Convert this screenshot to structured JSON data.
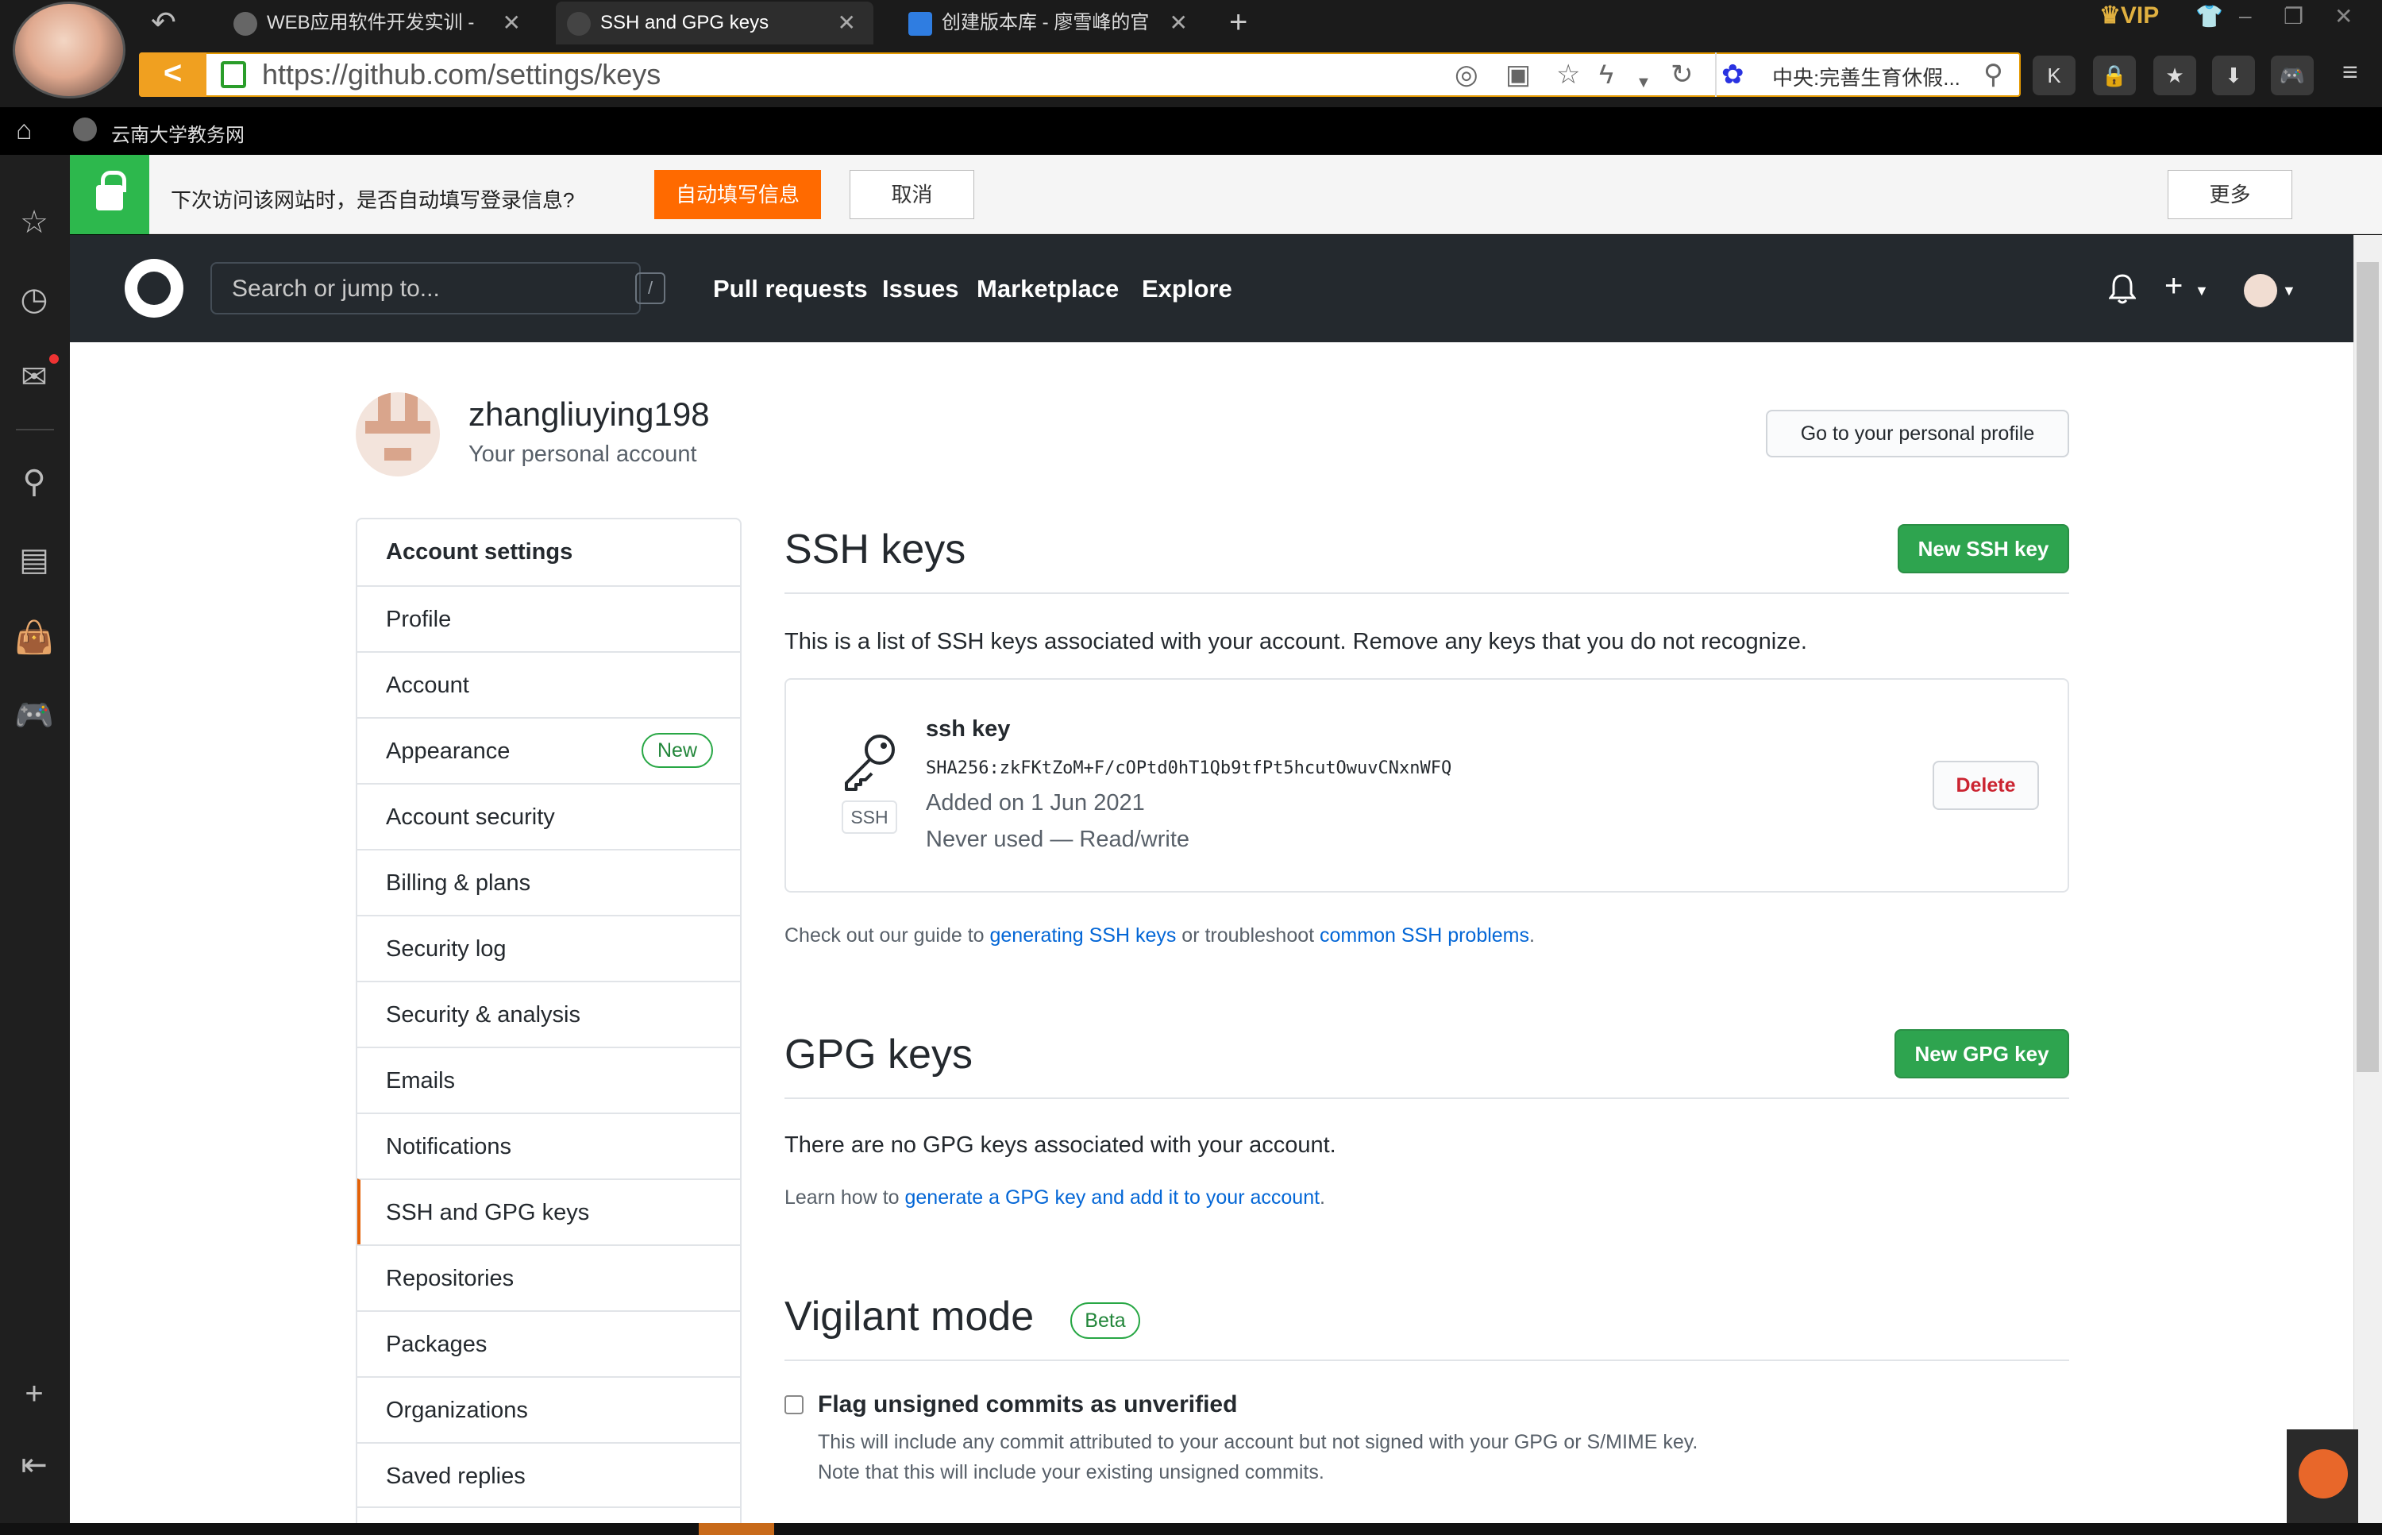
{
  "browser": {
    "tabs": [
      {
        "label": "WEB应用软件开发实训 -",
        "active": false
      },
      {
        "label": "SSH and GPG keys",
        "active": true
      },
      {
        "label": "创建版本库 - 廖雪峰的官",
        "active": false
      }
    ],
    "url": "https://github.com/settings/keys",
    "search_engine_text": "中央:完善生育休假...",
    "vip_label": "VIP",
    "bookmark": "云南大学教务网",
    "accent_color": "#e59a00"
  },
  "autofill": {
    "message": "下次访问该网站时，是否自动填写登录信息?",
    "confirm_label": "自动填写信息",
    "cancel_label": "取消",
    "more_label": "更多"
  },
  "github_header": {
    "search_placeholder": "Search or jump to...",
    "search_shortcut": "/",
    "nav": [
      "Pull requests",
      "Issues",
      "Marketplace",
      "Explore"
    ]
  },
  "account": {
    "username": "zhangliuying198",
    "subtitle": "Your personal account",
    "profile_button": "Go to your personal profile"
  },
  "settings_menu": {
    "items": [
      "Account settings",
      "Profile",
      "Account",
      "Appearance",
      "Account security",
      "Billing & plans",
      "Security log",
      "Security & analysis",
      "Emails",
      "Notifications",
      "SSH and GPG keys",
      "Repositories",
      "Packages",
      "Organizations",
      "Saved replies"
    ],
    "selected": "SSH and GPG keys",
    "new_badge": "New"
  },
  "ssh": {
    "title": "SSH keys",
    "new_button": "New SSH key",
    "description": "This is a list of SSH keys associated with your account. Remove any keys that you do not recognize.",
    "key": {
      "type_label": "SSH",
      "name": "ssh key",
      "fingerprint": "SHA256:zkFKtZoM+F/cOPtd0hT1Qb9tfPt5hcutOwuvCNxnWFQ",
      "added": "Added on 1 Jun 2021",
      "usage": "Never used — Read/write",
      "delete_label": "Delete"
    },
    "guide_prefix": "Check out our guide to ",
    "guide_link1": "generating SSH keys",
    "guide_middle": " or troubleshoot ",
    "guide_link2": "common SSH problems",
    "guide_suffix": "."
  },
  "gpg": {
    "title": "GPG keys",
    "new_button": "New GPG key",
    "empty": "There are no GPG keys associated with your account.",
    "learn_prefix": "Learn how to ",
    "learn_link": "generate a GPG key and add it to your account",
    "learn_suffix": "."
  },
  "vigilant": {
    "title": "Vigilant mode",
    "badge": "Beta",
    "checkbox_label": "Flag unsigned commits as unverified",
    "checked": false,
    "note1": "This will include any commit attributed to your account but not signed with your GPG or S/MIME key.",
    "note2": "Note that this will include your existing unsigned commits."
  }
}
